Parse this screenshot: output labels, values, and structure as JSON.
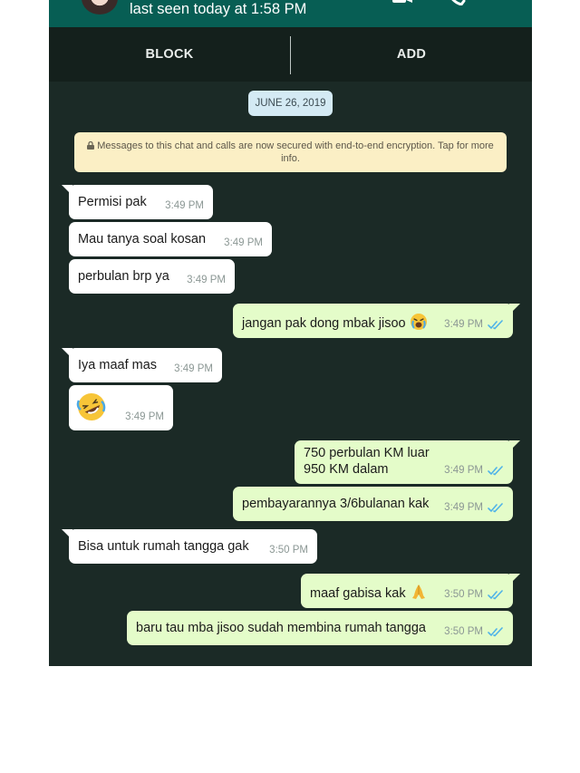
{
  "header": {
    "status": "last seen today at 1:58 PM"
  },
  "actions": {
    "block_label": "BLOCK",
    "add_label": "ADD"
  },
  "chat": {
    "date": "JUNE 26, 2019",
    "encryption_notice": "Messages to this chat and calls are now secured with end-to-end encryption. Tap for more info.",
    "messages": [
      {
        "direction": "in",
        "text": "Permisi pak",
        "time": "3:49 PM"
      },
      {
        "direction": "in",
        "text": "Mau tanya soal kosan",
        "time": "3:49 PM"
      },
      {
        "direction": "in",
        "text": "perbulan brp ya",
        "time": "3:49 PM"
      },
      {
        "direction": "out",
        "text": "jangan pak dong mbak jisoo",
        "emoji": "crying-face",
        "time": "3:49 PM",
        "read": true
      },
      {
        "direction": "in",
        "text": "Iya maaf mas",
        "time": "3:49 PM"
      },
      {
        "direction": "in",
        "text": "",
        "emoji": "rolling-laughing-face",
        "time": "3:49 PM"
      },
      {
        "direction": "out",
        "text_line1": "750 perbulan KM luar",
        "text_line2": "950 KM dalam",
        "time": "3:49 PM",
        "read": true
      },
      {
        "direction": "out",
        "text": "pembayarannya 3/6bulanan kak",
        "time": "3:49 PM",
        "read": true
      },
      {
        "direction": "in",
        "text": "Bisa untuk rumah tangga gak",
        "time": "3:50 PM"
      },
      {
        "direction": "out",
        "text": "maaf gabisa kak",
        "emoji": "folded-hands",
        "time": "3:50 PM",
        "read": true
      },
      {
        "direction": "out",
        "text": "baru tau mba jisoo sudah membina rumah tangga",
        "time": "3:50 PM",
        "read": true
      }
    ]
  },
  "colors": {
    "header": "#075e54",
    "chat_background": "#1b2a26",
    "incoming_bubble": "#ffffff",
    "outgoing_bubble": "#e4fcc9",
    "read_check": "#4fb3e8"
  }
}
